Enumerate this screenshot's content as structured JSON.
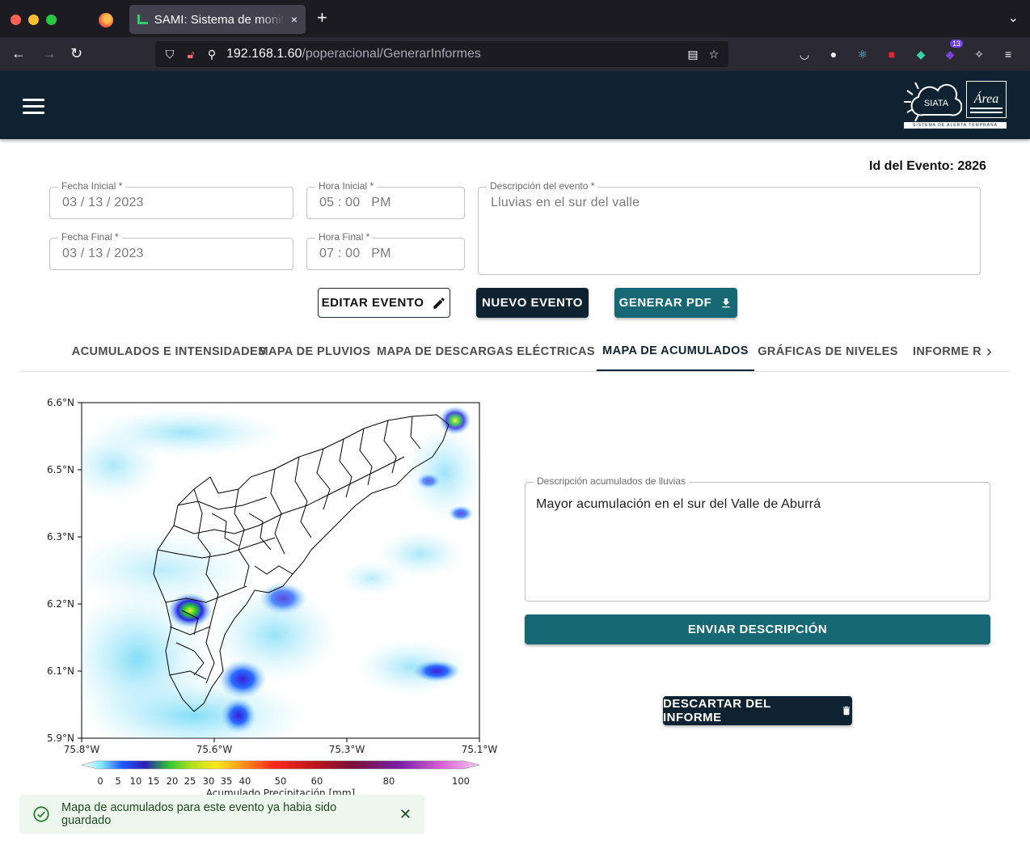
{
  "browser": {
    "tab_title": "SAMI: Sistema de monitoreo",
    "tab_close": "×",
    "new_tab": "+",
    "url_host": "192.168.1.60",
    "url_path": "/poperacional/GenerarInformes",
    "badge_count": "13"
  },
  "header": {
    "logo_text": "SIATA",
    "logo_area_text": "Área",
    "logo_strip": "SISTEMA DE ALERTA TEMPRANA"
  },
  "event": {
    "id_label": "Id del Evento: 2826",
    "fecha_inicial_label": "Fecha Inicial *",
    "fecha_inicial_value": "03 / 13 / 2023",
    "hora_inicial_label": "Hora Inicial *",
    "hora_inicial_value": "05 : 00   PM",
    "fecha_final_label": "Fecha Final *",
    "fecha_final_value": "03 / 13 / 2023",
    "hora_final_label": "Hora Final *",
    "hora_final_value": "07 : 00   PM",
    "descripcion_label": "Descripción del evento *",
    "descripcion_value": "Lluvias en el sur del valle"
  },
  "actions": {
    "editar": "EDITAR EVENTO",
    "nuevo": "NUEVO EVENTO",
    "generar_pdf": "GENERAR PDF"
  },
  "tabs": [
    {
      "label": "ACUMULADOS E INTENSIDADES"
    },
    {
      "label": "MAPA DE PLUVIOS"
    },
    {
      "label": "MAPA DE DESCARGAS ELÉCTRICAS"
    },
    {
      "label": "MAPA DE ACUMULADOS"
    },
    {
      "label": "GRÁFICAS DE NIVELES"
    },
    {
      "label": "INFORME R"
    }
  ],
  "map": {
    "lat_labels": [
      "6.6°N",
      "6.5°N",
      "6.3°N",
      "6.2°N",
      "6.1°N",
      "5.9°N"
    ],
    "lon_labels": [
      "75.8°W",
      "75.6°W",
      "75.3°W",
      "75.1°W"
    ],
    "colorbar_ticks": [
      "0",
      "5",
      "10",
      "15",
      "20",
      "25",
      "30",
      "35",
      "40",
      "50",
      "60",
      "80",
      "100"
    ],
    "colorbar_label": "Acumulado Precipitación [mm]"
  },
  "acumulados": {
    "desc_label": "Descripción acumulados de lluvias",
    "desc_value": "Mayor acumulación en el sur del Valle de Aburrá",
    "enviar": "ENVIAR DESCRIPCIÓN",
    "descartar": "DESCARTAR DEL INFORME"
  },
  "snackbar": {
    "message": "Mapa de acumulados para este evento ya habia sido guardado"
  }
}
